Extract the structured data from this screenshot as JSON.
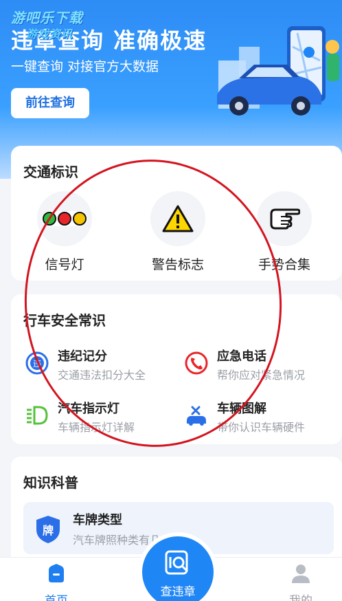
{
  "watermark": {
    "line1": "游吧乐下载",
    "line2": "游戏资讯"
  },
  "hero": {
    "title": "违章查询 准确极速",
    "subtitle": "一键查询  对接官方大数据",
    "button": "前往查询"
  },
  "traffic_signs": {
    "title": "交通标识",
    "items": [
      {
        "label": "信号灯",
        "icon": "traffic-light-icon"
      },
      {
        "label": "警告标志",
        "icon": "warning-sign-icon"
      },
      {
        "label": "手势合集",
        "icon": "hand-gesture-icon"
      }
    ]
  },
  "safety": {
    "title": "行车安全常识",
    "items": [
      {
        "title": "违纪记分",
        "desc": "交通违法扣分大全",
        "icon": "violation-points-icon"
      },
      {
        "title": "应急电话",
        "desc": "帮你应对紧急情况",
        "icon": "emergency-phone-icon"
      },
      {
        "title": "汽车指示灯",
        "desc": "车辆指示灯详解",
        "icon": "dashboard-light-icon"
      },
      {
        "title": "车辆图解",
        "desc": "带你认识车辆硬件",
        "icon": "car-diagram-icon"
      }
    ]
  },
  "knowledge": {
    "title": "知识科普",
    "item": {
      "title": "车牌类型",
      "desc": "汽车牌照种类有几",
      "badge": "牌",
      "icon": "license-plate-shield-icon"
    }
  },
  "tabbar": {
    "home": "首页",
    "center": "查违章",
    "mine": "我的"
  },
  "colors": {
    "primary": "#1f86f5",
    "annotation": "#d4141f"
  }
}
